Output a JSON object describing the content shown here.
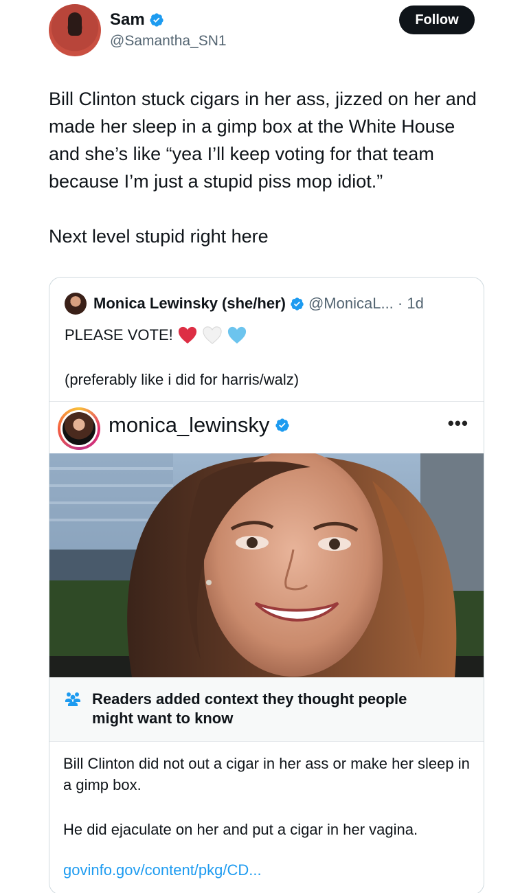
{
  "author": {
    "display_name": "Sam",
    "handle": "@Samantha_SN1",
    "avatar_icon": "profile-photo",
    "verified_icon": "verified-badge-icon"
  },
  "follow_button": {
    "label": "Follow"
  },
  "tweet": {
    "text": "Bill Clinton stuck cigars in her ass, jizzed on her and made her sleep in a gimp box at the White House and she’s like “yea I’ll keep voting for that team because I’m just a stupid piss mop idiot.”",
    "text2": "Next level stupid right here"
  },
  "quoted_tweet": {
    "display_name": "Monica Lewinsky (she/her)",
    "handle_time": "@MonicaL... · 1d",
    "line1": "PLEASE VOTE!",
    "line2": "(preferably like i did for harris/walz)",
    "hearts": [
      "red-heart-icon",
      "white-heart-icon",
      "blue-heart-icon"
    ]
  },
  "instagram": {
    "username": "monica_lewinsky",
    "more_label": "•••"
  },
  "community_note": {
    "title": "Readers added context they thought people might want to know",
    "body": "Bill Clinton did not out a cigar in her ass or make her sleep in a gimp box.",
    "body2": "He did ejaculate on her and put a cigar in her vagina.",
    "link": "govinfo.gov/content/pkg/CD..."
  },
  "colors": {
    "text": "#0f1419",
    "secondary": "#536471",
    "link": "#1d9bf0",
    "verified": "#1d9bf0",
    "follow_bg": "#0f1419"
  }
}
